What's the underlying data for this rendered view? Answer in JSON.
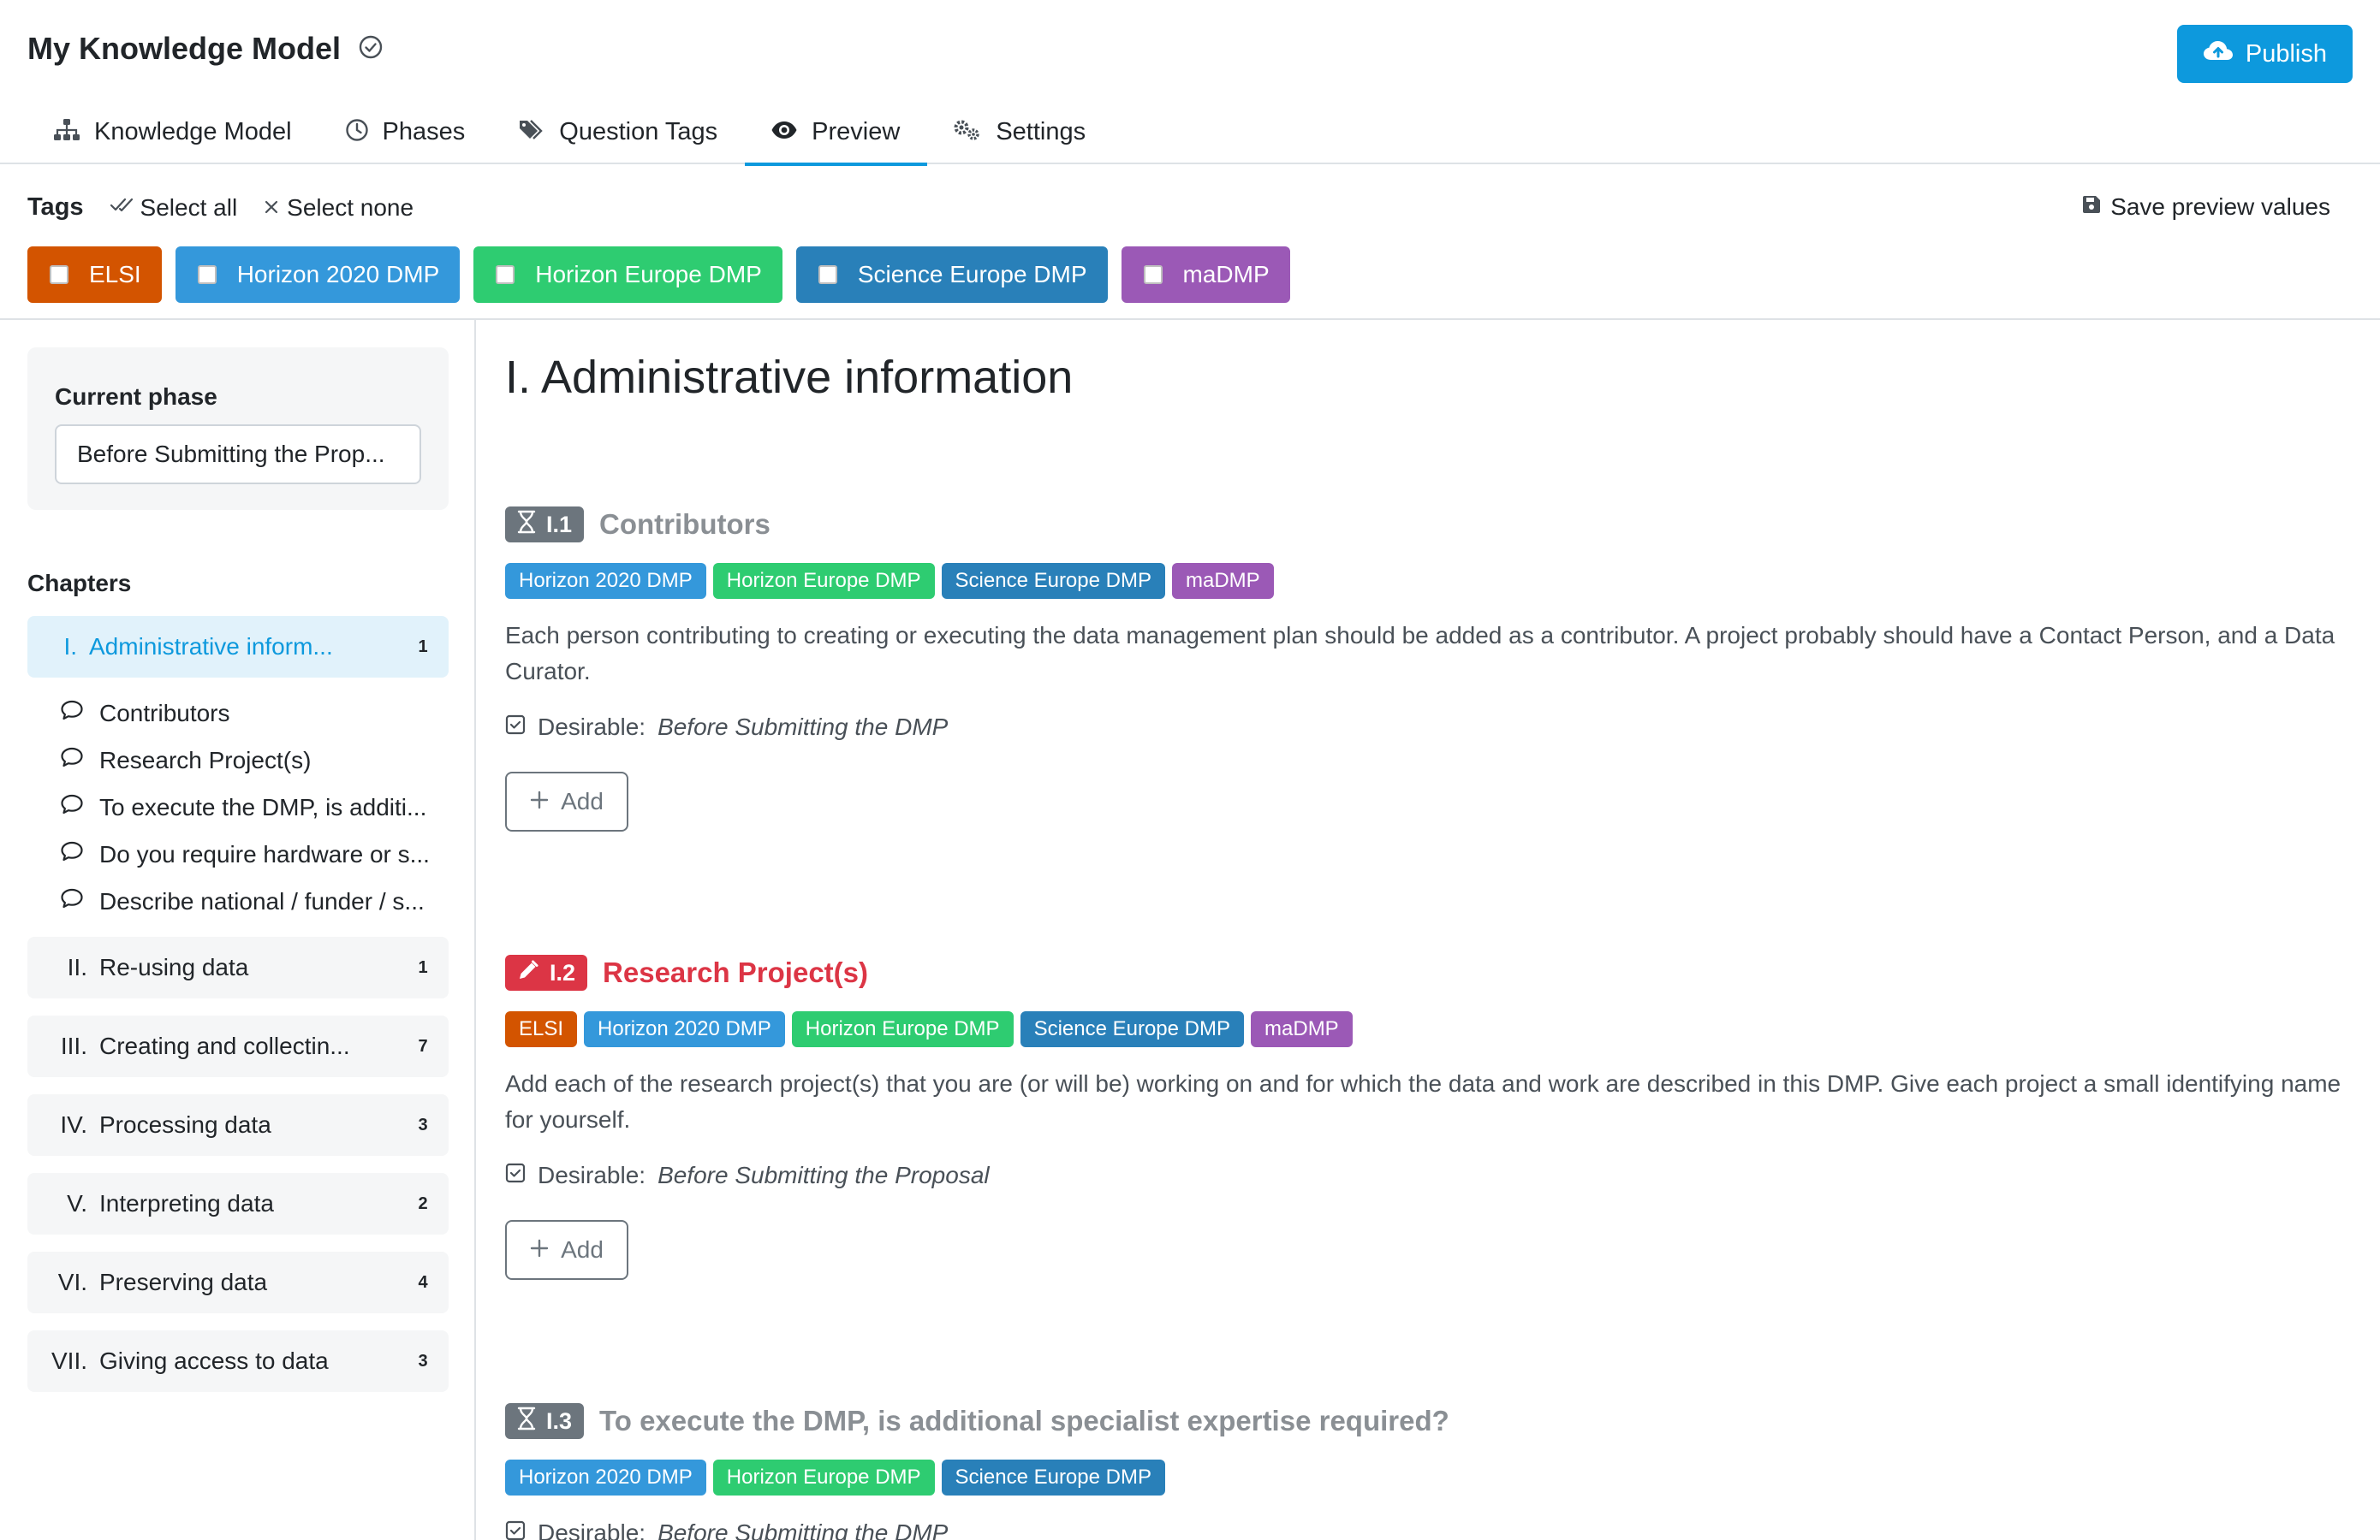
{
  "app": {
    "title": "My Knowledge Model",
    "publish_label": "Publish"
  },
  "tabs": [
    {
      "label": "Knowledge Model",
      "icon": "sitemap-icon"
    },
    {
      "label": "Phases",
      "icon": "clock-icon"
    },
    {
      "label": "Question Tags",
      "icon": "tags-icon"
    },
    {
      "label": "Preview",
      "icon": "eye-icon",
      "active": true
    },
    {
      "label": "Settings",
      "icon": "gears-icon"
    }
  ],
  "tagbar": {
    "label": "Tags",
    "select_all": "Select all",
    "select_none": "Select none",
    "save_values": "Save preview values",
    "tags": [
      {
        "label": "ELSI",
        "color": "#d35400"
      },
      {
        "label": "Horizon 2020 DMP",
        "color": "#3498db"
      },
      {
        "label": "Horizon Europe DMP",
        "color": "#2ecc71"
      },
      {
        "label": "Science Europe DMP",
        "color": "#2980b9"
      },
      {
        "label": "maDMP",
        "color": "#9b59b6"
      }
    ]
  },
  "sidebar": {
    "current_phase_label": "Current phase",
    "current_phase_value": "Before Submitting the Prop...",
    "chapters_label": "Chapters",
    "chapters": [
      {
        "num": "I.",
        "name": "Administrative inform...",
        "count": "1",
        "active": true
      },
      {
        "num": "II.",
        "name": "Re-using data",
        "count": "1"
      },
      {
        "num": "III.",
        "name": "Creating and collectin...",
        "count": "7"
      },
      {
        "num": "IV.",
        "name": "Processing data",
        "count": "3"
      },
      {
        "num": "V.",
        "name": "Interpreting data",
        "count": "2"
      },
      {
        "num": "VI.",
        "name": "Preserving data",
        "count": "4"
      },
      {
        "num": "VII.",
        "name": "Giving access to data",
        "count": "3"
      }
    ],
    "subitems": [
      "Contributors",
      "Research Project(s)",
      "To execute the DMP, is additi...",
      "Do you require hardware or s...",
      "Describe national / funder / s..."
    ]
  },
  "content": {
    "chapter_title": "I. Administrative information",
    "desirable_label": "Desirable:",
    "add_label": "Add",
    "questions": [
      {
        "number": "I.1",
        "title": "Contributors",
        "state": "pending",
        "color": "#6c757d",
        "title_color": "#8a8f94",
        "tags": [
          {
            "label": "Horizon 2020 DMP",
            "color": "#3498db"
          },
          {
            "label": "Horizon Europe DMP",
            "color": "#2ecc71"
          },
          {
            "label": "Science Europe DMP",
            "color": "#2980b9"
          },
          {
            "label": "maDMP",
            "color": "#9b59b6"
          }
        ],
        "text": "Each person contributing to creating or executing the data management plan should be added as a contributor. A project probably should have a Contact Person, and a Data Curator.",
        "desirable_phase": "Before Submitting the DMP"
      },
      {
        "number": "I.2",
        "title": "Research Project(s)",
        "state": "required",
        "color": "#dc3545",
        "title_color": "#dc3545",
        "tags": [
          {
            "label": "ELSI",
            "color": "#d35400"
          },
          {
            "label": "Horizon 2020 DMP",
            "color": "#3498db"
          },
          {
            "label": "Horizon Europe DMP",
            "color": "#2ecc71"
          },
          {
            "label": "Science Europe DMP",
            "color": "#2980b9"
          },
          {
            "label": "maDMP",
            "color": "#9b59b6"
          }
        ],
        "text": "Add each of the research project(s) that you are (or will be) working on and for which the data and work are described in this DMP. Give each project a small identifying name for yourself.",
        "desirable_phase": "Before Submitting the Proposal"
      },
      {
        "number": "I.3",
        "title": "To execute the DMP, is additional specialist expertise required?",
        "state": "pending",
        "color": "#6c757d",
        "title_color": "#8a8f94",
        "tags": [
          {
            "label": "Horizon 2020 DMP",
            "color": "#3498db"
          },
          {
            "label": "Horizon Europe DMP",
            "color": "#2ecc71"
          },
          {
            "label": "Science Europe DMP",
            "color": "#2980b9"
          }
        ],
        "text": "",
        "desirable_phase": "Before Submitting the DMP"
      }
    ]
  }
}
